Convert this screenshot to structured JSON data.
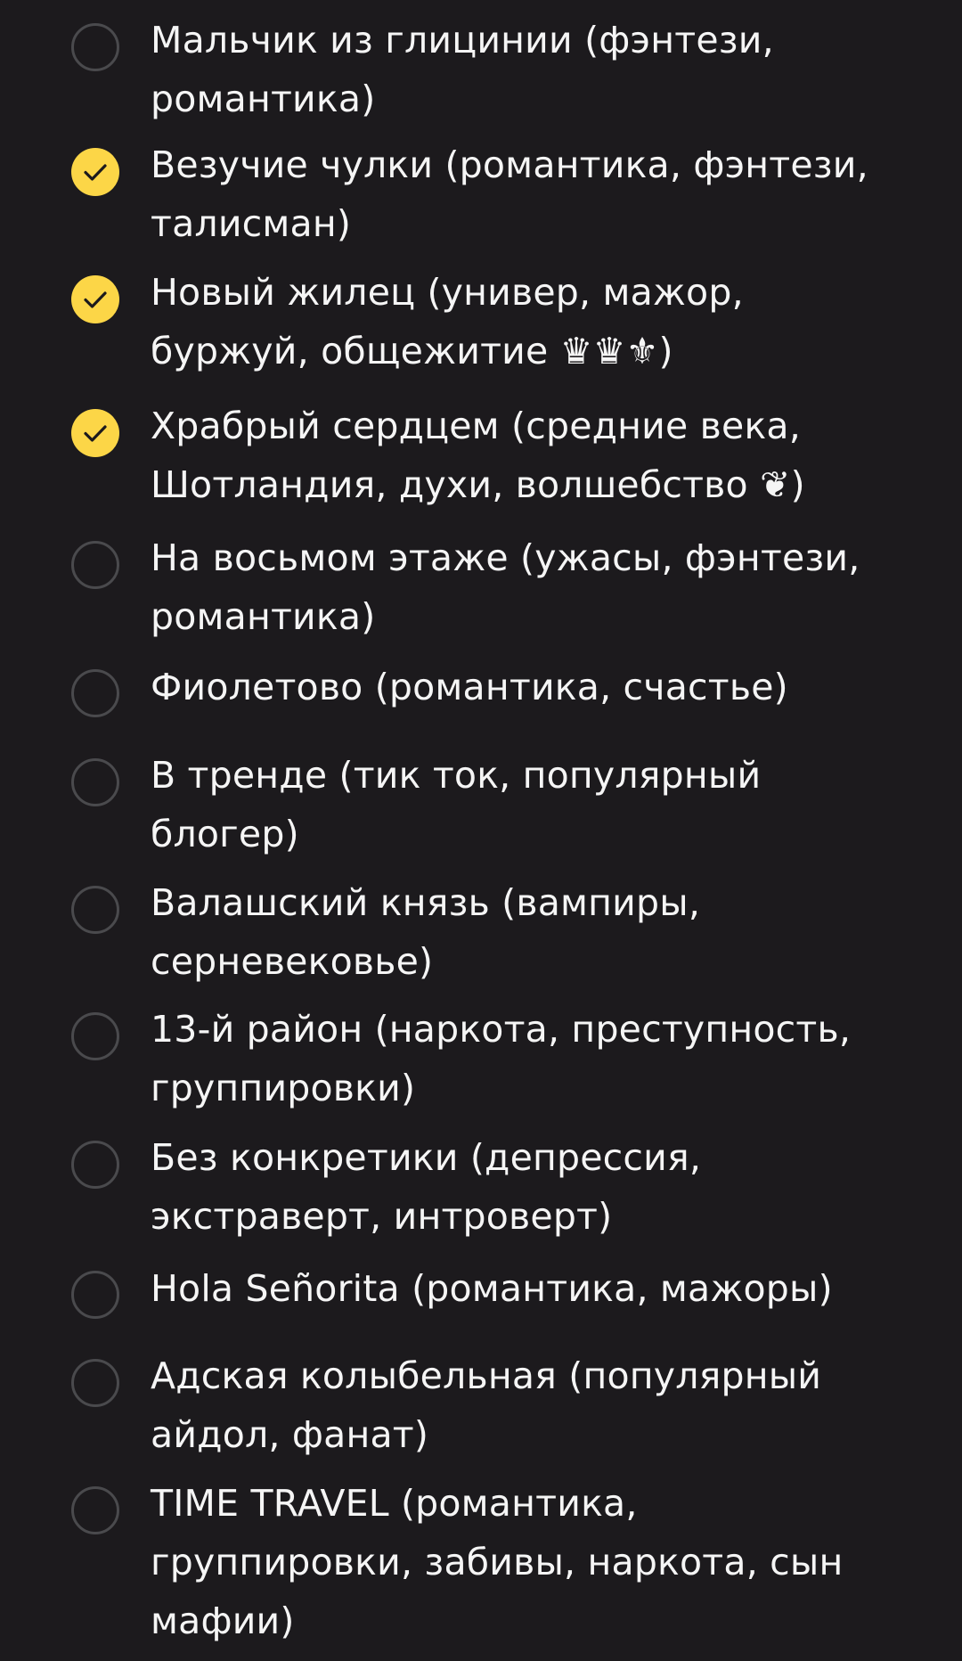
{
  "poll": {
    "accent_color": "#fcd647",
    "options": [
      {
        "label": "Мальчик из глицинии (фэнтези, романтика)",
        "selected": false
      },
      {
        "label": "Везучие чулки (романтика, фэнтези, талисман)",
        "selected": true
      },
      {
        "label": "Новый жилец (универ, мажор, буржуй, общежитие ♛♛⚜)",
        "selected": true
      },
      {
        "label": "Храбрый сердцем (средние века, Шотландия, духи, волшебство ❦)",
        "selected": true
      },
      {
        "label": "На восьмом этаже (ужасы, фэнтези, романтика)",
        "selected": false
      },
      {
        "label": "Фиолетово (романтика, счастье)",
        "selected": false
      },
      {
        "label": "В тренде (тик ток, популярный блогер)",
        "selected": false
      },
      {
        "label": "Валашский князь (вампиры, серневековье)",
        "selected": false
      },
      {
        "label": "13-й район (наркота, преступность, группировки)",
        "selected": false
      },
      {
        "label": "Без конкретики (депрессия, экстраверт, интроверт)",
        "selected": false
      },
      {
        "label": "Hola Señorita (романтика, мажоры)",
        "selected": false
      },
      {
        "label": "Адская колыбельная (популярный айдол, фанат)",
        "selected": false
      },
      {
        "label": "TIME TRAVEL (романтика, группировки, забивы, наркота, сын мафии)",
        "selected": false
      }
    ]
  }
}
